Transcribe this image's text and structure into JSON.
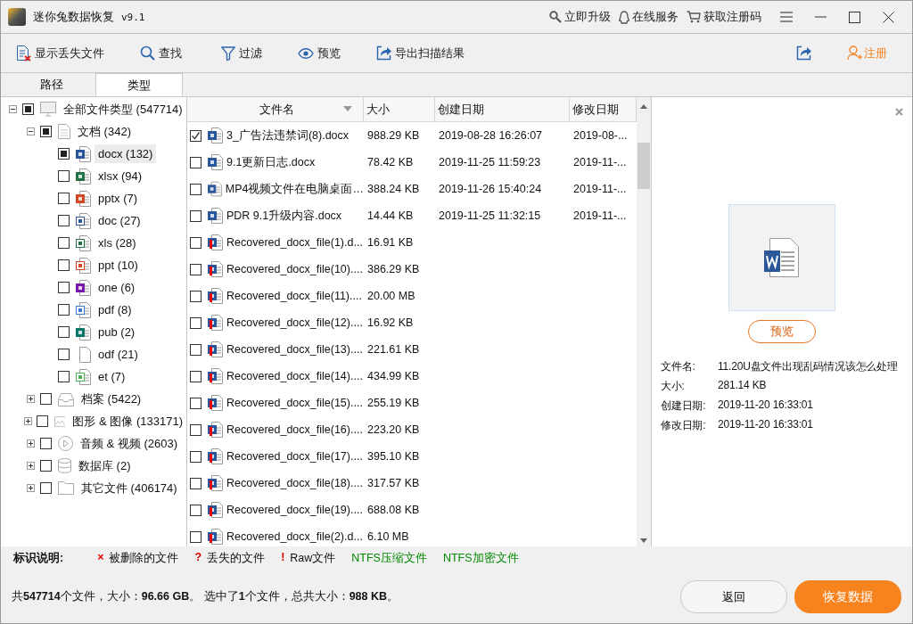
{
  "window": {
    "title": "迷你兔数据恢复",
    "version": "v9.1",
    "links": [
      {
        "kind": "upgrade",
        "label": "立即升级"
      },
      {
        "kind": "service",
        "label": "在线服务"
      },
      {
        "kind": "cart",
        "label": "获取注册码"
      }
    ]
  },
  "toolbar": {
    "items": [
      {
        "kind": "lost",
        "label": "显示丢失文件"
      },
      {
        "kind": "search",
        "label": "查找"
      },
      {
        "kind": "filter",
        "label": "过滤"
      },
      {
        "kind": "preview",
        "label": "预览"
      },
      {
        "kind": "export",
        "label": "导出扫描结果"
      }
    ],
    "register": "注册"
  },
  "tabs": [
    {
      "label": "路径",
      "selected": false
    },
    {
      "label": "类型",
      "selected": true
    }
  ],
  "tree": {
    "label": "全部文件类型 (547714)",
    "kind": "computer",
    "checked": false,
    "partial": true,
    "expanded": true,
    "selected": false,
    "children": [
      {
        "label": "文档 (342)",
        "kind": "page",
        "checked": false,
        "partial": true,
        "expanded": true,
        "selected": false,
        "children": [
          {
            "label": "docx (132)",
            "kind": "word",
            "checked": false,
            "partial": true,
            "selected": true
          },
          {
            "label": "xlsx (94)",
            "kind": "excel",
            "checked": false,
            "partial": false,
            "selected": false
          },
          {
            "label": "pptx (7)",
            "kind": "powerpoint",
            "checked": false,
            "partial": false,
            "selected": false
          },
          {
            "label": "doc (27)",
            "kind": "word97",
            "checked": false,
            "partial": false,
            "selected": false
          },
          {
            "label": "xls (28)",
            "kind": "excel97",
            "checked": false,
            "partial": false,
            "selected": false
          },
          {
            "label": "ppt (10)",
            "kind": "powerpoint97",
            "checked": false,
            "partial": false,
            "selected": false
          },
          {
            "label": "one (6)",
            "kind": "onenote",
            "checked": false,
            "partial": false,
            "selected": false
          },
          {
            "label": "pdf (8)",
            "kind": "pdf",
            "checked": false,
            "partial": false,
            "selected": false
          },
          {
            "label": "pub (2)",
            "kind": "publisher",
            "checked": false,
            "partial": false,
            "selected": false
          },
          {
            "label": "odf (21)",
            "kind": "blank",
            "checked": false,
            "partial": false,
            "selected": false
          },
          {
            "label": "et (7)",
            "kind": "sheet",
            "checked": false,
            "partial": false,
            "selected": false
          }
        ]
      },
      {
        "label": "档案 (5422)",
        "kind": "archive",
        "checked": false,
        "partial": false,
        "expanded": false,
        "selected": false
      },
      {
        "label": "图形 & 图像 (133171)",
        "kind": "image",
        "checked": false,
        "partial": false,
        "expanded": false,
        "selected": false
      },
      {
        "label": "音频 & 视频 (2603)",
        "kind": "media",
        "checked": false,
        "partial": false,
        "expanded": false,
        "selected": false
      },
      {
        "label": "数据库 (2)",
        "kind": "database",
        "checked": false,
        "partial": false,
        "expanded": false,
        "selected": false
      },
      {
        "label": "其它文件 (406174)",
        "kind": "folder",
        "checked": false,
        "partial": false,
        "expanded": false,
        "selected": false
      }
    ]
  },
  "table": {
    "columns": [
      "文件名",
      "大小",
      "创建日期",
      "修改日期"
    ],
    "rows": [
      {
        "kind": "normal",
        "checked": true,
        "name": "3_广告法违禁词(8).docx",
        "size": "988.29 KB",
        "created": "2019-08-28 16:26:07",
        "modified": "2019-08-..."
      },
      {
        "kind": "normal",
        "checked": false,
        "name": "9.1更新日志.docx",
        "size": "78.42 KB",
        "created": "2019-11-25 11:59:23",
        "modified": "2019-11-..."
      },
      {
        "kind": "normal",
        "checked": false,
        "name": "MP4视频文件在电脑桌面…",
        "size": "388.24 KB",
        "created": "2019-11-26 15:40:24",
        "modified": "2019-11-..."
      },
      {
        "kind": "normal",
        "checked": false,
        "name": "PDR 9.1升级内容.docx",
        "size": "14.44 KB",
        "created": "2019-11-25 11:32:15",
        "modified": "2019-11-..."
      },
      {
        "kind": "raw",
        "checked": false,
        "name": "Recovered_docx_file(1).d...",
        "size": "16.91 KB"
      },
      {
        "kind": "raw",
        "checked": false,
        "name": "Recovered_docx_file(10)....",
        "size": "386.29 KB"
      },
      {
        "kind": "raw",
        "checked": false,
        "name": "Recovered_docx_file(11)....",
        "size": "20.00 MB"
      },
      {
        "kind": "raw",
        "checked": false,
        "name": "Recovered_docx_file(12)....",
        "size": "16.92 KB"
      },
      {
        "kind": "raw",
        "checked": false,
        "name": "Recovered_docx_file(13)....",
        "size": "221.61 KB"
      },
      {
        "kind": "raw",
        "checked": false,
        "name": "Recovered_docx_file(14)....",
        "size": "434.99 KB"
      },
      {
        "kind": "raw",
        "checked": false,
        "name": "Recovered_docx_file(15)....",
        "size": "255.19 KB"
      },
      {
        "kind": "raw",
        "checked": false,
        "name": "Recovered_docx_file(16)....",
        "size": "223.20 KB"
      },
      {
        "kind": "raw",
        "checked": false,
        "name": "Recovered_docx_file(17)....",
        "size": "395.10 KB"
      },
      {
        "kind": "raw",
        "checked": false,
        "name": "Recovered_docx_file(18)....",
        "size": "317.57 KB"
      },
      {
        "kind": "raw",
        "checked": false,
        "name": "Recovered_docx_file(19)....",
        "size": "688.08 KB"
      },
      {
        "kind": "raw",
        "checked": false,
        "name": "Recovered_docx_file(2).d...",
        "size": "6.10 MB"
      }
    ]
  },
  "preview": {
    "button": "预览",
    "info": [
      {
        "label": "文件名:",
        "value": "11.20U盘文件出现乱码情况该怎么处理"
      },
      {
        "label": "大小:",
        "value": "281.14 KB"
      },
      {
        "label": "创建日期:",
        "value": "2019-11-20 16:33:01"
      },
      {
        "label": "修改日期:",
        "value": "2019-11-20 16:33:01"
      }
    ]
  },
  "legend": {
    "title": "标识说明:",
    "items": [
      {
        "marker": "×",
        "text": "被删除的文件",
        "color": "#e00000"
      },
      {
        "marker": "?",
        "text": "丢失的文件",
        "color": "#e00000"
      },
      {
        "marker": "!",
        "text": "Raw文件",
        "color": "#e00000"
      },
      {
        "text": "NTFS压缩文件",
        "color": "#008a00"
      },
      {
        "text": "NTFS加密文件",
        "color": "#008a00"
      }
    ]
  },
  "status": {
    "summary": "共**547714**个文件，大小：**96.66 GB**。 选中了**1**个文件，总共大小：**988 KB**。",
    "back": "返回",
    "recover": "恢复数据"
  }
}
